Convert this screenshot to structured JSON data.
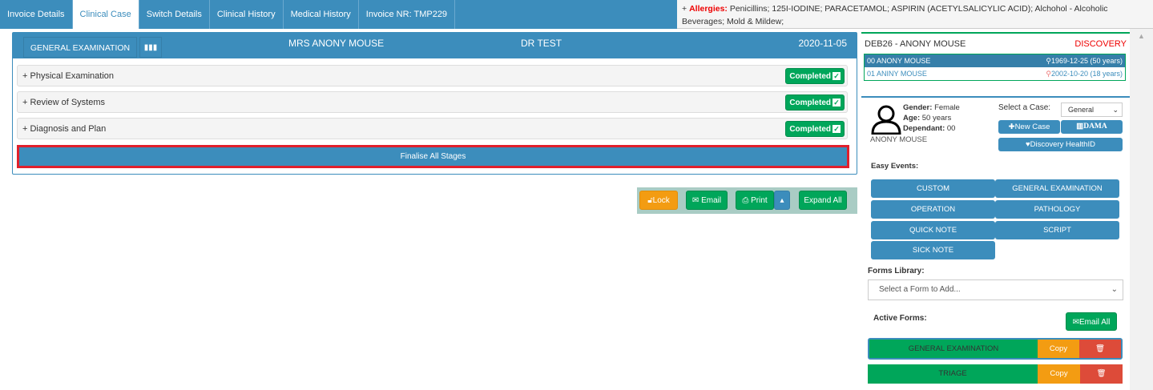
{
  "tabs": [
    "Invoice Details",
    "Clinical Case",
    "Switch Details",
    "Clinical History",
    "Medical History",
    "Invoice NR: TMP229"
  ],
  "allergies": {
    "label": "Allergies:",
    "text": "Penicillins; 125I-IODINE; PARACETAMOL; ASPIRIN (ACETYLSALICYLIC ACID); Alchohol - Alcoholic Beverages; Mold & Mildew;"
  },
  "main": {
    "form_button": "GENERAL EXAMINATION",
    "patient": "MRS ANONY MOUSE",
    "doctor": "DR TEST",
    "date": "2020-11-05",
    "stages": [
      {
        "label": "Physical Examination",
        "status": "Completed"
      },
      {
        "label": "Review of Systems",
        "status": "Completed"
      },
      {
        "label": "Diagnosis and Plan",
        "status": "Completed"
      }
    ],
    "finalise": "Finalise All Stages"
  },
  "actions": {
    "lock": "Lock",
    "email": "Email",
    "print": "Print",
    "expand": "Expand All"
  },
  "patient_box": {
    "title": "DEB26 - ANONY MOUSE",
    "scheme": "DISCOVERY",
    "members": [
      {
        "name": "00 ANONY MOUSE",
        "dob": "1969-12-25 (50 years)"
      },
      {
        "name": "01 ANINY MOUSE",
        "dob": "2002-10-20 (18 years)"
      }
    ]
  },
  "case": {
    "gender_label": "Gender:",
    "gender": "Female",
    "age_label": "Age:",
    "age": "50 years",
    "dep_label": "Dependant:",
    "dep": "00",
    "name": "ANONY MOUSE",
    "select_label": "Select a Case:",
    "select_value": "General",
    "new_case": "New Case",
    "dama": "DAMA",
    "healthid": "Discovery HealthID",
    "easy_label": "Easy Events:",
    "events": [
      "CUSTOM",
      "GENERAL EXAMINATION",
      "OPERATION",
      "PATHOLOGY",
      "QUICK NOTE",
      "SCRIPT",
      "SICK NOTE"
    ],
    "forms_label": "Forms Library:",
    "forms_placeholder": "Select a Form to Add...",
    "active_label": "Active Forms:",
    "email_all": "Email All",
    "active_forms": [
      {
        "name": "GENERAL EXAMINATION",
        "copy": "Copy"
      },
      {
        "name": "TRIAGE",
        "copy": "Copy"
      }
    ]
  }
}
